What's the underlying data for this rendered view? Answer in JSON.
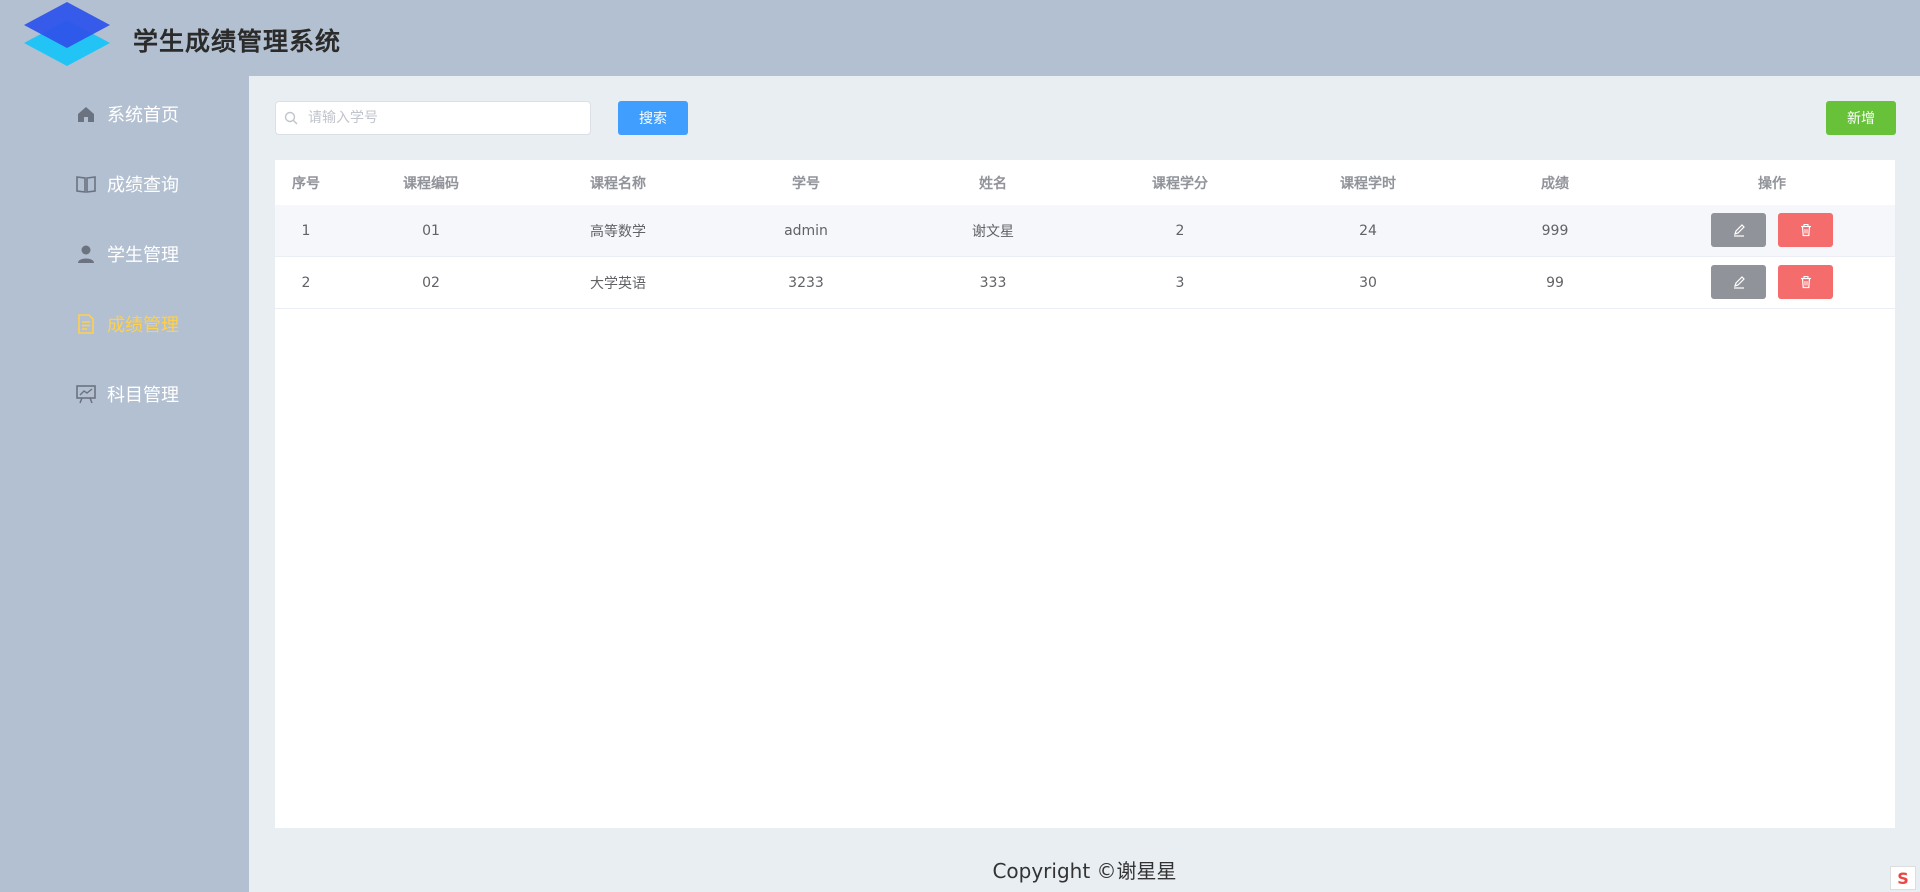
{
  "app": {
    "title": "学生成绩管理系统"
  },
  "sidebar": {
    "items": [
      {
        "label": "系统首页",
        "icon": "home-icon",
        "active": false
      },
      {
        "label": "成绩查询",
        "icon": "book-icon",
        "active": false
      },
      {
        "label": "学生管理",
        "icon": "user-icon",
        "active": false
      },
      {
        "label": "成绩管理",
        "icon": "document-icon",
        "active": true
      },
      {
        "label": "科目管理",
        "icon": "chart-board-icon",
        "active": false
      }
    ],
    "active_color": "#ffd04b"
  },
  "toolbar": {
    "search_placeholder": "请输入学号",
    "search_label": "搜索",
    "add_label": "新增"
  },
  "table": {
    "columns": [
      "序号",
      "课程编码",
      "课程名称",
      "学号",
      "姓名",
      "课程学分",
      "课程学时",
      "成绩",
      "操作"
    ],
    "rows": [
      [
        "1",
        "01",
        "高等数学",
        "admin",
        "谢文星",
        "2",
        "24",
        "999"
      ],
      [
        "2",
        "02",
        "大学英语",
        "3233",
        "333",
        "3",
        "30",
        "99"
      ]
    ]
  },
  "footer": {
    "text": "Copyright ©谢星星"
  },
  "corner": {
    "badge": "S"
  },
  "colors": {
    "primary": "#409eff",
    "success": "#67c23a",
    "danger": "#f56c6c",
    "info": "#909399"
  }
}
